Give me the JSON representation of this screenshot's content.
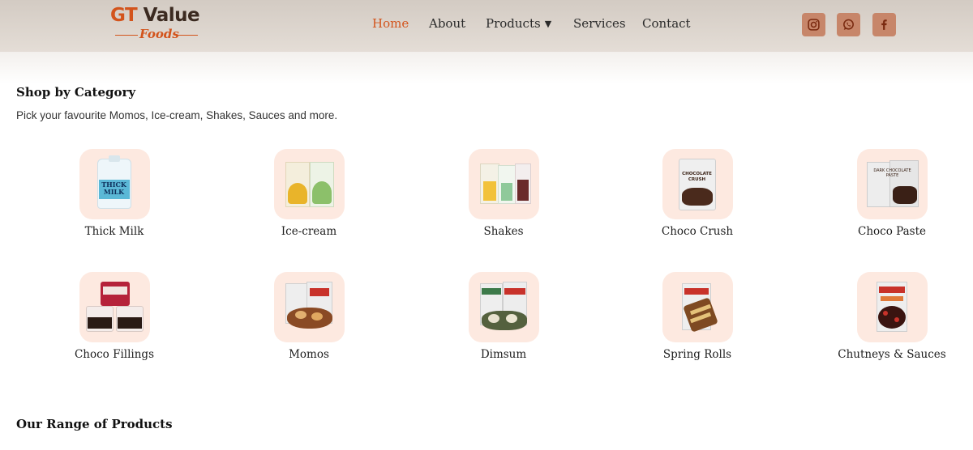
{
  "brand": {
    "logo_main_1": "GT",
    "logo_main_2": " Value",
    "logo_sub": "Foods"
  },
  "nav": [
    {
      "label": "Home",
      "active": true
    },
    {
      "label": "About"
    },
    {
      "label": "Products"
    },
    {
      "label": "Services"
    },
    {
      "label": "Contact"
    }
  ],
  "social": [
    "instagram-icon",
    "whatsapp-icon",
    "facebook-icon"
  ],
  "colors": {
    "accent": "#d3541c",
    "tile_bg": "#fde9e0",
    "social_bg": "#c7866a"
  },
  "shop": {
    "title": "Shop by Category",
    "subtitle": "Pick your favourite Momos, Ice-cream, Shakes, Sauces and more.",
    "categories": [
      {
        "label": "Thick Milk",
        "product_label": "THICK MILK"
      },
      {
        "label": "Ice-cream"
      },
      {
        "label": "Shakes"
      },
      {
        "label": "Choco Crush",
        "product_label": "CHOCOLATE CRUSH"
      },
      {
        "label": "Choco Paste",
        "product_label": "DARK CHOCOLATE PASTE"
      },
      {
        "label": "Choco Fillings"
      },
      {
        "label": "Momos"
      },
      {
        "label": "Dimsum"
      },
      {
        "label": "Spring Rolls"
      },
      {
        "label": "Chutneys & Sauces"
      }
    ]
  },
  "range": {
    "title": "Our Range of Products"
  }
}
